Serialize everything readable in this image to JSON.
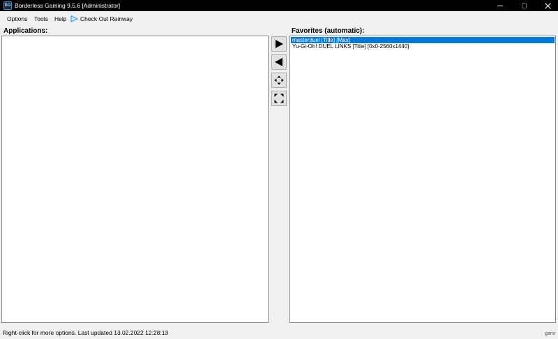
{
  "window": {
    "title": "Borderless Gaming 9.5.6 [Administrator]",
    "icon_text": "BG"
  },
  "menu": {
    "options": "Options",
    "tools": "Tools",
    "help": "Help",
    "rainway": "Check Out Rainway",
    "rainway_icon": "play-triangle-icon"
  },
  "applications": {
    "label": "Applications:",
    "items": []
  },
  "favorites": {
    "label": "Favorites (automatic):",
    "items": [
      "masterduel [Title] [Max]",
      "Yu-Gi-Oh! DUEL LINKS [Title] [0x0-2560x1440]"
    ],
    "selected_index": 0
  },
  "toolbar": {
    "add_icon": "arrow-right-icon",
    "remove_icon": "arrow-left-icon",
    "fullscreen_icon": "expand-arrows-icon",
    "restore_icon": "collapse-arrows-icon"
  },
  "status": {
    "text": "Right-click for more options. Last updated 13.02.2022 12:28:13"
  },
  "watermark": "gamr",
  "colors": {
    "titlebar": "#000000",
    "selection": "#0078d7",
    "accent_icon": "#3a8fd8"
  }
}
